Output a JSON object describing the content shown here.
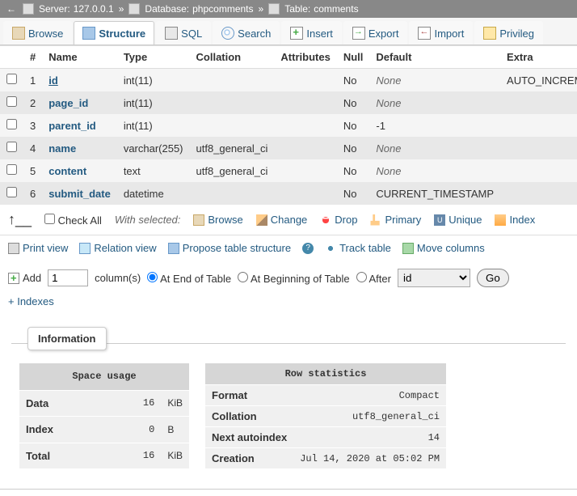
{
  "breadcrumb": {
    "server_label": "Server:",
    "server": "127.0.0.1",
    "db_label": "Database:",
    "db": "phpcomments",
    "table_label": "Table:",
    "table": "comments"
  },
  "tabs": {
    "browse": "Browse",
    "structure": "Structure",
    "sql": "SQL",
    "search": "Search",
    "insert": "Insert",
    "export": "Export",
    "import": "Import",
    "privileges": "Privileg"
  },
  "headers": {
    "num": "#",
    "name": "Name",
    "type": "Type",
    "collation": "Collation",
    "attributes": "Attributes",
    "null": "Null",
    "default": "Default",
    "extra": "Extra"
  },
  "cols": [
    {
      "n": "1",
      "name": "id",
      "pk": true,
      "type": "int(11)",
      "coll": "",
      "attr": "",
      "null": "No",
      "def": "None",
      "def_italic": true,
      "extra": "AUTO_INCREMENT"
    },
    {
      "n": "2",
      "name": "page_id",
      "pk": false,
      "type": "int(11)",
      "coll": "",
      "attr": "",
      "null": "No",
      "def": "None",
      "def_italic": true,
      "extra": ""
    },
    {
      "n": "3",
      "name": "parent_id",
      "pk": false,
      "type": "int(11)",
      "coll": "",
      "attr": "",
      "null": "No",
      "def": "-1",
      "def_italic": false,
      "extra": ""
    },
    {
      "n": "4",
      "name": "name",
      "pk": false,
      "type": "varchar(255)",
      "coll": "utf8_general_ci",
      "attr": "",
      "null": "No",
      "def": "None",
      "def_italic": true,
      "extra": ""
    },
    {
      "n": "5",
      "name": "content",
      "pk": false,
      "type": "text",
      "coll": "utf8_general_ci",
      "attr": "",
      "null": "No",
      "def": "None",
      "def_italic": true,
      "extra": ""
    },
    {
      "n": "6",
      "name": "submit_date",
      "pk": false,
      "type": "datetime",
      "coll": "",
      "attr": "",
      "null": "No",
      "def": "CURRENT_TIMESTAMP",
      "def_italic": false,
      "extra": ""
    }
  ],
  "toolbar": {
    "check_all": "Check All",
    "with_selected": "With selected:",
    "browse": "Browse",
    "change": "Change",
    "drop": "Drop",
    "primary": "Primary",
    "unique": "Unique",
    "index": "Index"
  },
  "toolbar2": {
    "print": "Print view",
    "relation": "Relation view",
    "propose": "Propose table structure",
    "track": "Track table",
    "move": "Move columns"
  },
  "add": {
    "label": "Add",
    "count": "1",
    "columns": "column(s)",
    "end": "At End of Table",
    "begin": "At Beginning of Table",
    "after": "After",
    "after_col": "id",
    "go": "Go"
  },
  "indexes_toggle": "+ Indexes",
  "info": {
    "legend": "Information",
    "space_caption": "Space usage",
    "space": [
      {
        "k": "Data",
        "v": "16",
        "u": "KiB"
      },
      {
        "k": "Index",
        "v": "0",
        "u": "B"
      },
      {
        "k": "Total",
        "v": "16",
        "u": "KiB"
      }
    ],
    "rows_caption": "Row statistics",
    "rows": [
      {
        "k": "Format",
        "v": "Compact"
      },
      {
        "k": "Collation",
        "v": "utf8_general_ci"
      },
      {
        "k": "Next autoindex",
        "v": "14"
      },
      {
        "k": "Creation",
        "v": "Jul 14, 2020 at 05:02 PM"
      }
    ]
  }
}
